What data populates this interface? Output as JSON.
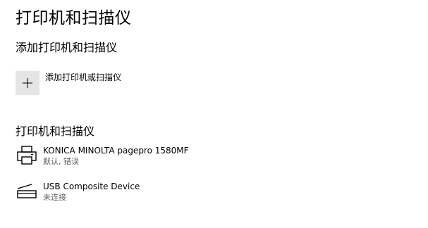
{
  "page": {
    "title": "打印机和扫描仪"
  },
  "add_section": {
    "heading": "添加打印机和扫描仪",
    "add_button_label": "添加打印机或扫描仪",
    "add_icon": "plus-icon"
  },
  "devices_section": {
    "heading": "打印机和扫描仪",
    "devices": [
      {
        "name": "KONICA MINOLTA pagepro 1580MF",
        "status": "默认, 错误",
        "icon": "printer-icon"
      },
      {
        "name": "USB Composite Device",
        "status": "未连接",
        "icon": "scanner-icon"
      }
    ]
  },
  "colors": {
    "tile_background": "#e5e5e5",
    "secondary_text": "#606060"
  }
}
